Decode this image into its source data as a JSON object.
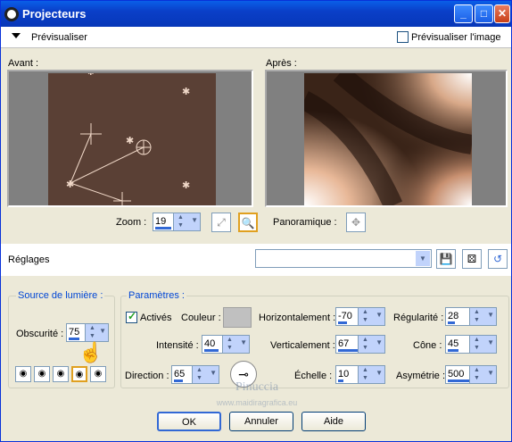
{
  "window": {
    "title": "Projecteurs",
    "min": "_",
    "max": "□",
    "close": "✕"
  },
  "preview": {
    "label": "Prévisualiser",
    "image_label": "Prévisualiser l'image"
  },
  "panes": {
    "before": "Avant :",
    "after": "Après :"
  },
  "zoom": {
    "label": "Zoom :",
    "value": "19"
  },
  "pan_label": "Panoramique :",
  "settings": {
    "label": "Réglages",
    "value": ""
  },
  "light_source": {
    "title": "Source de lumière :",
    "darkness_label": "Obscurité :",
    "darkness_value": "75"
  },
  "params": {
    "title": "Paramètres :",
    "active_label": "Activés",
    "color_label": "Couleur :",
    "intensity_label": "Intensité :",
    "intensity": "40",
    "direction_label": "Direction :",
    "direction": "65",
    "horizontal_label": "Horizontalement :",
    "horizontal": "-70",
    "vertical_label": "Verticalement :",
    "vertical": "67",
    "scale_label": "Échelle :",
    "scale": "10",
    "regularity_label": "Régularité :",
    "regularity": "28",
    "cone_label": "Cône :",
    "cone": "45",
    "asymmetry_label": "Asymétrie :",
    "asymmetry": "500"
  },
  "buttons": {
    "ok": "OK",
    "cancel": "Annuler",
    "help": "Aide"
  },
  "watermark": {
    "name": "Pinuccia",
    "url": "www.maidiragrafica.eu"
  },
  "colors": {
    "accent": "#0046d5",
    "titlebar": "#0a3fc8"
  }
}
